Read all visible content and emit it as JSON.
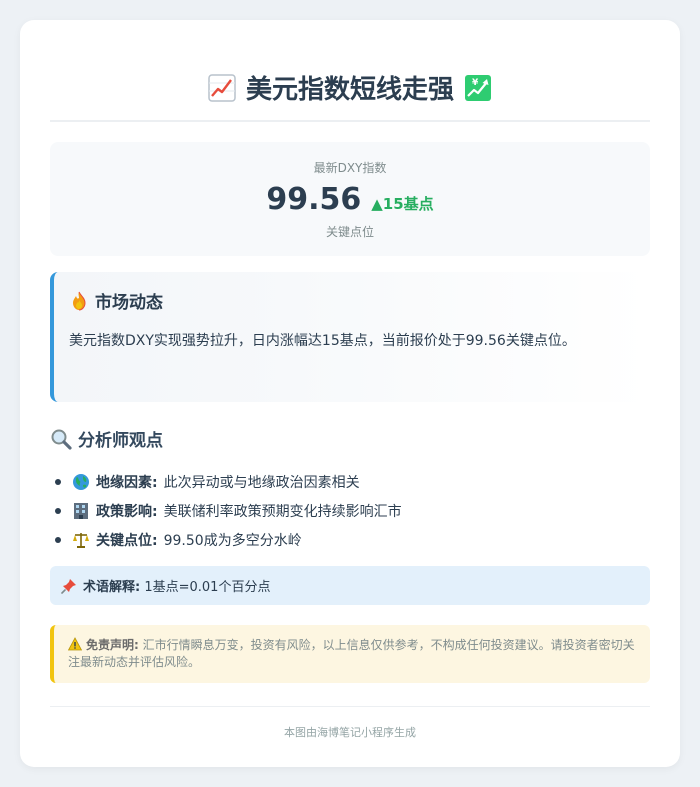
{
  "header": {
    "title": "美元指数短线走强",
    "left_icon": "chart-up-icon",
    "right_icon": "chart-yen-up-icon"
  },
  "index": {
    "label": "最新DXY指数",
    "value": "99.56",
    "change": "▲15基点",
    "sub": "关键点位"
  },
  "market": {
    "icon": "fire-icon",
    "title": "市场动态",
    "text": "美元指数DXY实现强势拉升，日内涨幅达15基点，当前报价处于99.56关键点位。"
  },
  "analyst": {
    "icon": "magnifier-icon",
    "title": "分析师观点",
    "items": [
      {
        "icon": "globe-icon",
        "title": "地缘因素:",
        "text": " 此次异动或与地缘政治因素相关"
      },
      {
        "icon": "office-building-icon",
        "title": "政策影响:",
        "text": " 美联储利率政策预期变化持续影响汇市"
      },
      {
        "icon": "scales-icon",
        "title": "关键点位:",
        "text": " 99.50成为多空分水岭"
      }
    ]
  },
  "term": {
    "icon": "pushpin-icon",
    "title": "术语解释:",
    "text": " 1基点=0.01个百分点"
  },
  "disclaimer": {
    "icon": "warning-icon",
    "title": "免责声明:",
    "text": " 汇市行情瞬息万变，投资有风险，以上信息仅供参考，不构成任何投资建议。请投资者密切关注最新动态并评估风险。"
  },
  "footer": {
    "text": "本图由海博笔记小程序生成"
  },
  "colors": {
    "accent_blue": "#3498db",
    "positive_green": "#27ae60",
    "warning_yellow": "#f1c40f",
    "term_bg": "#e3f0fb"
  }
}
